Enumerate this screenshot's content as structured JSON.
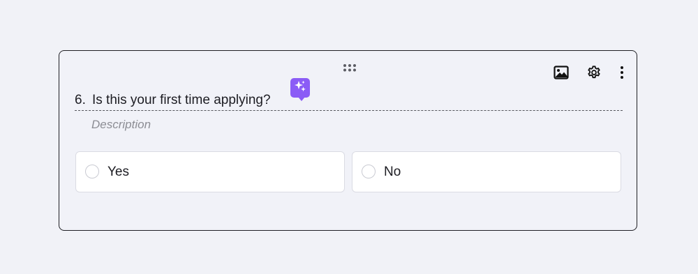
{
  "question": {
    "number": "6.",
    "text": "Is this your first time applying?",
    "description_placeholder": "Description"
  },
  "options": [
    {
      "label": "Yes"
    },
    {
      "label": "No"
    }
  ],
  "toolbar": {
    "icons": [
      "image-icon",
      "gear-icon",
      "more-vertical-icon"
    ]
  },
  "colors": {
    "background": "#f1f2f7",
    "card_border": "#1f1f24",
    "ai_accent": "#8b5cf6",
    "placeholder": "#8c8d94"
  }
}
